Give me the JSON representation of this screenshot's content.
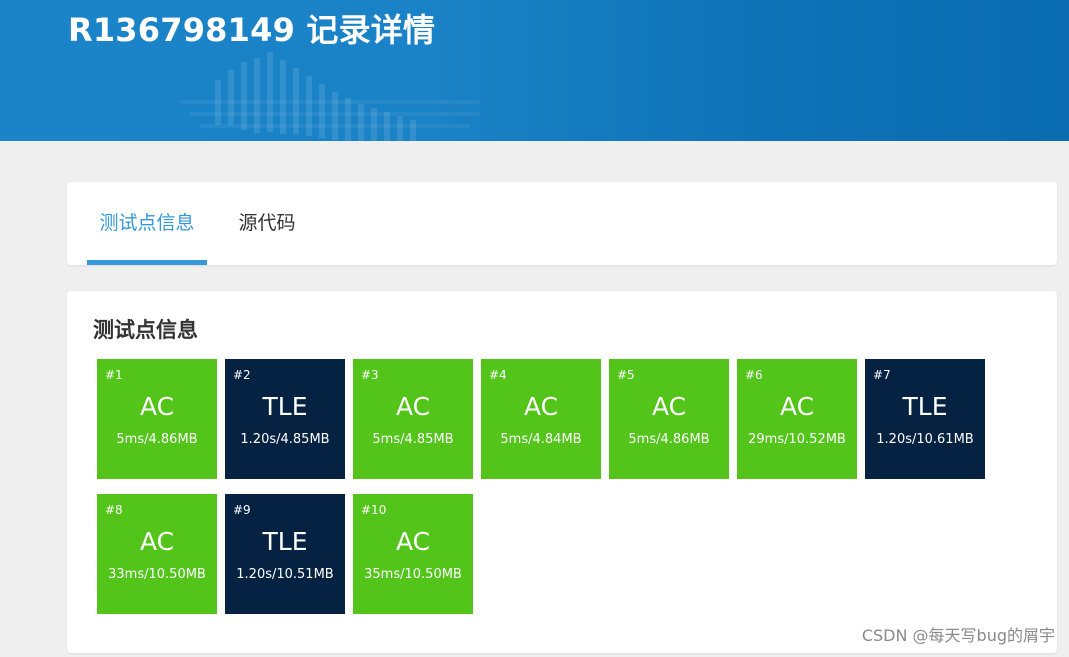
{
  "header": {
    "title": "R136798149 记录详情"
  },
  "tabs": [
    {
      "label": "测试点信息",
      "active": true
    },
    {
      "label": "源代码",
      "active": false
    }
  ],
  "section": {
    "title": "测试点信息"
  },
  "colors": {
    "ac": "#52c41a",
    "tle": "#052243",
    "accent": "#3498db"
  },
  "testcases": [
    {
      "num": "#1",
      "status": "AC",
      "meta": "5ms/4.86MB"
    },
    {
      "num": "#2",
      "status": "TLE",
      "meta": "1.20s/4.85MB"
    },
    {
      "num": "#3",
      "status": "AC",
      "meta": "5ms/4.85MB"
    },
    {
      "num": "#4",
      "status": "AC",
      "meta": "5ms/4.84MB"
    },
    {
      "num": "#5",
      "status": "AC",
      "meta": "5ms/4.86MB"
    },
    {
      "num": "#6",
      "status": "AC",
      "meta": "29ms/10.52MB"
    },
    {
      "num": "#7",
      "status": "TLE",
      "meta": "1.20s/10.61MB"
    },
    {
      "num": "#8",
      "status": "AC",
      "meta": "33ms/10.50MB"
    },
    {
      "num": "#9",
      "status": "TLE",
      "meta": "1.20s/10.51MB"
    },
    {
      "num": "#10",
      "status": "AC",
      "meta": "35ms/10.50MB"
    }
  ],
  "watermark": "CSDN @每天写bug的屑宇"
}
